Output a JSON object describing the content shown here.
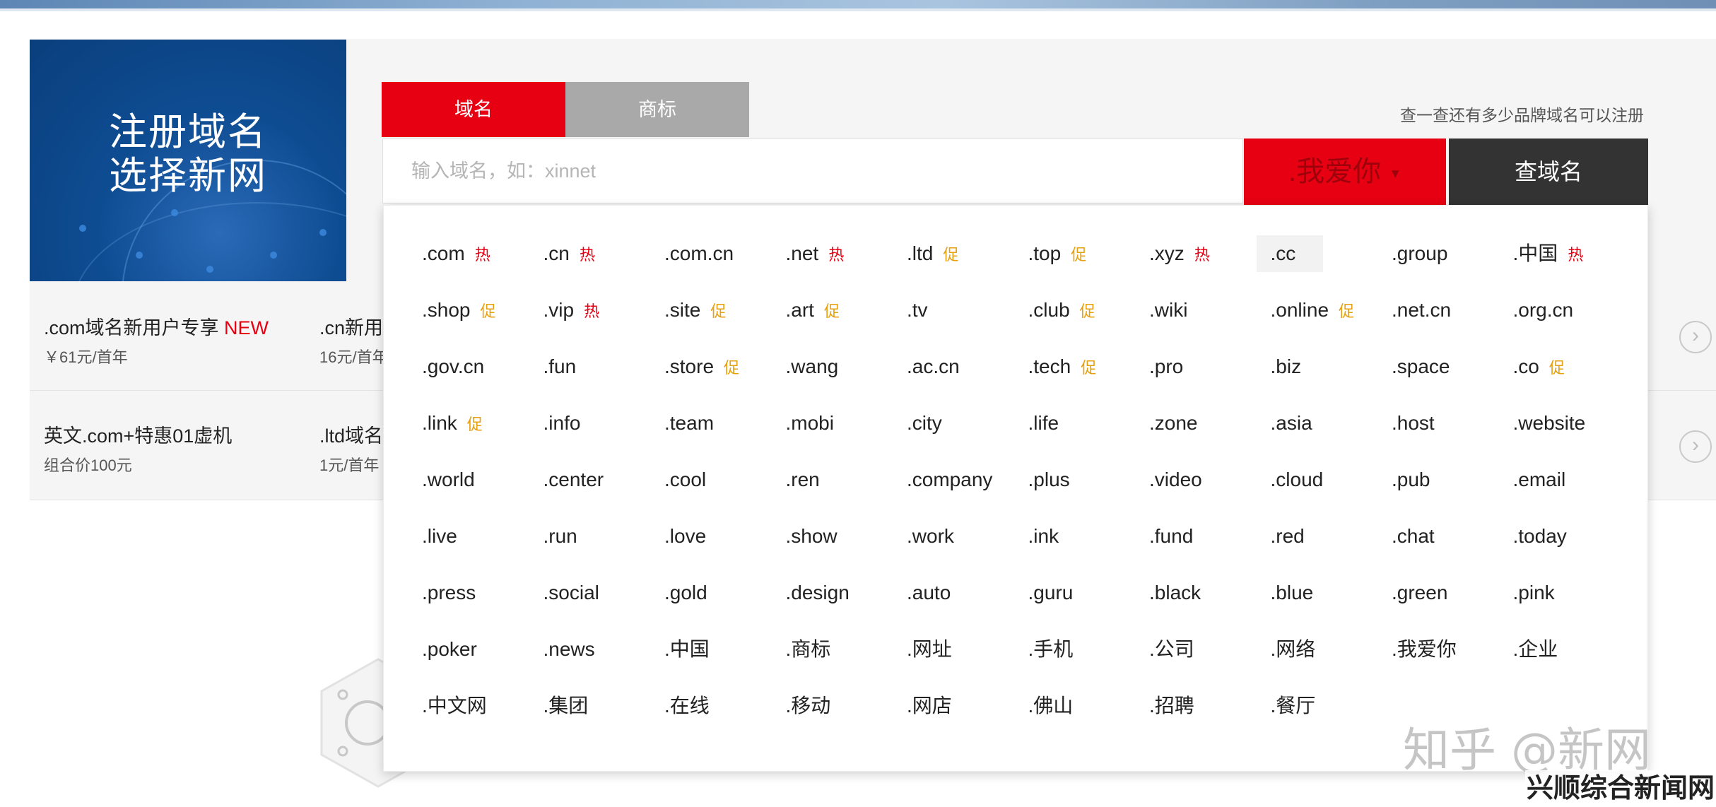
{
  "banner": {
    "line1": "注册域名",
    "line2": "选择新网"
  },
  "tabs": [
    {
      "label": "域名"
    },
    {
      "label": "商标"
    }
  ],
  "hint": "查一查还有多少品牌域名可以注册",
  "search": {
    "placeholder": "输入域名，如：xinnet",
    "suffix": ".我爱你",
    "button": "查域名"
  },
  "promos": [
    {
      "title": ".com域名新用户专享",
      "badge": "NEW",
      "price": "￥61元/首年"
    },
    {
      "title": ".cn新用",
      "price": "16元/首年"
    },
    {
      "title": "英文.com+特惠01虚机",
      "price": "组合价100元"
    },
    {
      "title": ".ltd域名",
      "price": "1元/首年"
    }
  ],
  "tld_rows": [
    [
      {
        "name": ".com",
        "tag": "热",
        "kind": "hot"
      },
      {
        "name": ".cn",
        "tag": "热",
        "kind": "hot"
      },
      {
        "name": ".com.cn"
      },
      {
        "name": ".net",
        "tag": "热",
        "kind": "hot"
      },
      {
        "name": ".ltd",
        "tag": "促",
        "kind": "promo"
      },
      {
        "name": ".top",
        "tag": "促",
        "kind": "promo"
      },
      {
        "name": ".xyz",
        "tag": "热",
        "kind": "hot"
      },
      {
        "name": ".cc",
        "hover": true
      },
      {
        "name": ".group"
      },
      {
        "name": ".中国",
        "tag": "热",
        "kind": "hot"
      }
    ],
    [
      {
        "name": ".shop",
        "tag": "促",
        "kind": "promo"
      },
      {
        "name": ".vip",
        "tag": "热",
        "kind": "hot"
      },
      {
        "name": ".site",
        "tag": "促",
        "kind": "promo"
      },
      {
        "name": ".art",
        "tag": "促",
        "kind": "promo"
      },
      {
        "name": ".tv"
      },
      {
        "name": ".club",
        "tag": "促",
        "kind": "promo"
      },
      {
        "name": ".wiki"
      },
      {
        "name": ".online",
        "tag": "促",
        "kind": "promo"
      },
      {
        "name": ".net.cn"
      },
      {
        "name": ".org.cn"
      }
    ],
    [
      {
        "name": ".gov.cn"
      },
      {
        "name": ".fun"
      },
      {
        "name": ".store",
        "tag": "促",
        "kind": "promo"
      },
      {
        "name": ".wang"
      },
      {
        "name": ".ac.cn"
      },
      {
        "name": ".tech",
        "tag": "促",
        "kind": "promo"
      },
      {
        "name": ".pro"
      },
      {
        "name": ".biz"
      },
      {
        "name": ".space"
      },
      {
        "name": ".co",
        "tag": "促",
        "kind": "promo"
      }
    ],
    [
      {
        "name": ".link",
        "tag": "促",
        "kind": "promo"
      },
      {
        "name": ".info"
      },
      {
        "name": ".team"
      },
      {
        "name": ".mobi"
      },
      {
        "name": ".city"
      },
      {
        "name": ".life"
      },
      {
        "name": ".zone"
      },
      {
        "name": ".asia"
      },
      {
        "name": ".host"
      },
      {
        "name": ".website"
      }
    ],
    [
      {
        "name": ".world"
      },
      {
        "name": ".center"
      },
      {
        "name": ".cool"
      },
      {
        "name": ".ren"
      },
      {
        "name": ".company"
      },
      {
        "name": ".plus"
      },
      {
        "name": ".video"
      },
      {
        "name": ".cloud"
      },
      {
        "name": ".pub"
      },
      {
        "name": ".email"
      }
    ],
    [
      {
        "name": ".live"
      },
      {
        "name": ".run"
      },
      {
        "name": ".love"
      },
      {
        "name": ".show"
      },
      {
        "name": ".work"
      },
      {
        "name": ".ink"
      },
      {
        "name": ".fund"
      },
      {
        "name": ".red"
      },
      {
        "name": ".chat"
      },
      {
        "name": ".today"
      }
    ],
    [
      {
        "name": ".press"
      },
      {
        "name": ".social"
      },
      {
        "name": ".gold"
      },
      {
        "name": ".design"
      },
      {
        "name": ".auto"
      },
      {
        "name": ".guru"
      },
      {
        "name": ".black"
      },
      {
        "name": ".blue"
      },
      {
        "name": ".green"
      },
      {
        "name": ".pink"
      }
    ],
    [
      {
        "name": ".poker"
      },
      {
        "name": ".news"
      },
      {
        "name": ".中国"
      },
      {
        "name": ".商标"
      },
      {
        "name": ".网址"
      },
      {
        "name": ".手机"
      },
      {
        "name": ".公司"
      },
      {
        "name": ".网络"
      },
      {
        "name": ".我爱你"
      },
      {
        "name": ".企业"
      }
    ],
    [
      {
        "name": ".中文网"
      },
      {
        "name": ".集团"
      },
      {
        "name": ".在线"
      },
      {
        "name": ".移动"
      },
      {
        "name": ".网店"
      },
      {
        "name": ".佛山"
      },
      {
        "name": ".招聘"
      },
      {
        "name": ".餐厅"
      }
    ]
  ],
  "watermarks": {
    "zhihu": "知乎 @新网",
    "site": "兴顺综合新闻网"
  }
}
